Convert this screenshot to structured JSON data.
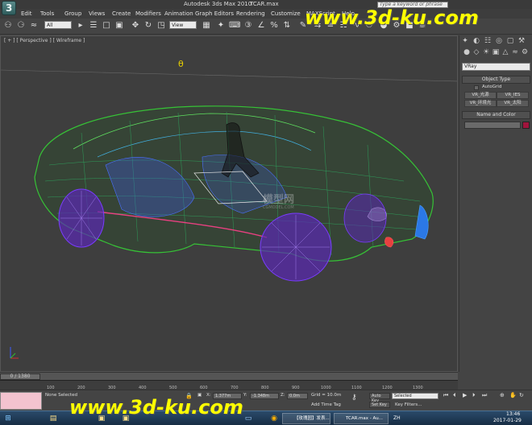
{
  "title_bar": {
    "app_title": "Autodesk 3ds Max  2010",
    "file_name": "TCAR.max",
    "search_placeholder": "Type a keyword or phrase"
  },
  "menu": [
    "Edit",
    "Tools",
    "Group",
    "Views",
    "Create",
    "Modifiers",
    "Animation",
    "Graph Editors",
    "Rendering",
    "Customize",
    "MAXScript",
    "Help"
  ],
  "toolbar": {
    "selection_filter": "All",
    "ref_coord": "View"
  },
  "viewport": {
    "label": "[ + ] [ Perspective ] [ Wireframe ]",
    "pivot_glyph": "θ",
    "model_watermark": "模型网",
    "model_watermark_sub": "CGMODEL.COM"
  },
  "command_panel": {
    "renderer_dropdown": "VRay",
    "object_type_title": "Object Type",
    "autogrid_label": "AutoGrid",
    "buttons": [
      "VR_光源",
      "VR_IES",
      "VR_环境光",
      "VR_太阳"
    ],
    "name_color_title": "Name and Color",
    "color_swatch": "#a0143c"
  },
  "timeline": {
    "frame_counter": "0 / 1380",
    "ticks": [
      "100",
      "200",
      "300",
      "400",
      "500",
      "600",
      "700",
      "800",
      "900",
      "1000",
      "1100",
      "1200",
      "1300"
    ]
  },
  "status": {
    "selection": "None Selected",
    "x_label": "X:",
    "x_value": "1.377m",
    "y_label": "Y:",
    "y_value": "-1.348m",
    "z_label": "Z:",
    "z_value": "0.0m",
    "grid": "Grid = 10.0m",
    "add_time_tag": "Add Time Tag",
    "auto_key": "Auto Key",
    "set_key": "Set Key",
    "key_mode": "Selected",
    "key_filters": "Key Filters..."
  },
  "taskbar": {
    "items": [
      "【玫瑰园】发表...",
      "TCAR.max - Au..."
    ],
    "lang": "ZH",
    "time": "13:46",
    "date": "2017-01-29"
  },
  "watermark": "www.3d-ku.com"
}
